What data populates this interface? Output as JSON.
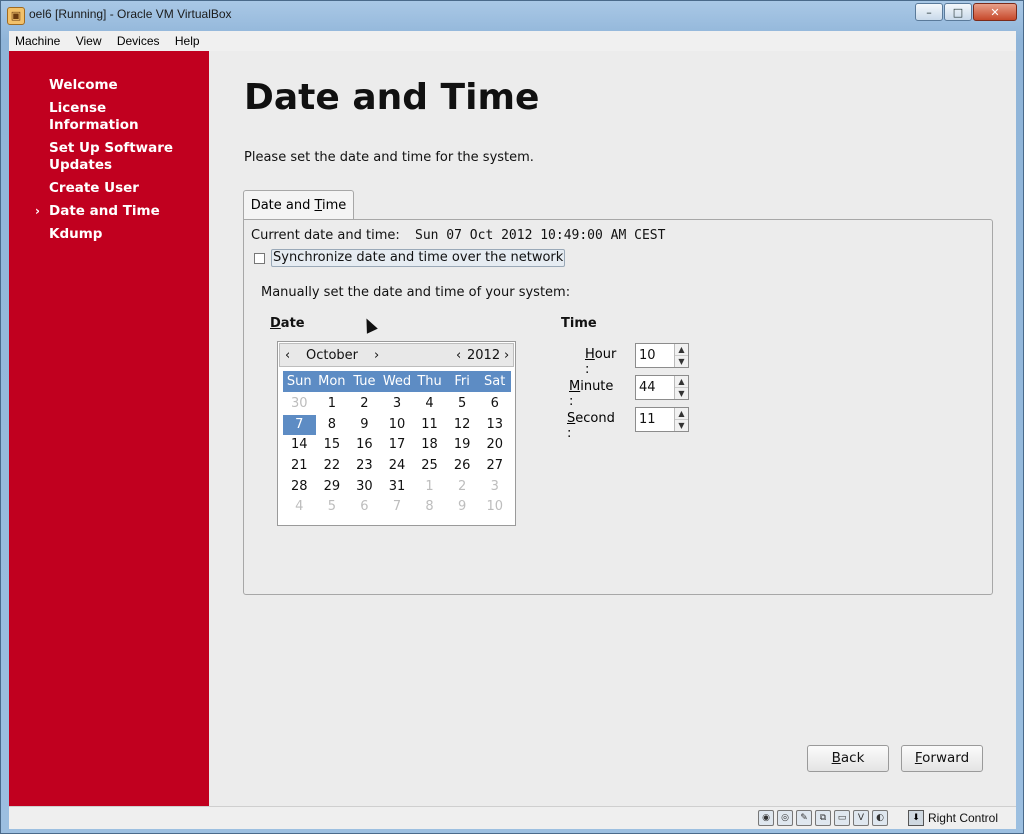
{
  "window": {
    "title": "oel6 [Running] - Oracle VM VirtualBox",
    "menus": [
      "Machine",
      "View",
      "Devices",
      "Help"
    ]
  },
  "sidebar": {
    "items": [
      {
        "label": "Welcome",
        "active": false
      },
      {
        "label": "License Information",
        "active": false
      },
      {
        "label": "Set Up Software Updates",
        "active": false
      },
      {
        "label": "Create User",
        "active": false
      },
      {
        "label": "Date and Time",
        "active": true
      },
      {
        "label": "Kdump",
        "active": false
      }
    ],
    "active_marker": "›"
  },
  "page": {
    "title": "Date and Time",
    "subtitle": "Please set the date and time for the system.",
    "tab_label_pre": "Date and ",
    "tab_label_key": "T",
    "tab_label_post": "ime",
    "current_label": "Current date and time:",
    "current_value": "Sun 07 Oct 2012 10:49:00 AM CEST",
    "sync_label": "Synchronize date and time over the network",
    "sync_checked": false,
    "manual_label": "Manually set the date and time of your system:",
    "date_header_key": "D",
    "date_header_rest": "ate",
    "time_header": "Time"
  },
  "calendar": {
    "month": "October",
    "year": "2012",
    "prev_month": "‹",
    "next_month": "›",
    "prev_year": "‹",
    "next_year": "›",
    "weekdays": [
      "Sun",
      "Mon",
      "Tue",
      "Wed",
      "Thu",
      "Fri",
      "Sat"
    ],
    "days": [
      {
        "d": "30",
        "dim": true
      },
      {
        "d": "1"
      },
      {
        "d": "2"
      },
      {
        "d": "3"
      },
      {
        "d": "4"
      },
      {
        "d": "5"
      },
      {
        "d": "6"
      },
      {
        "d": "7",
        "sel": true
      },
      {
        "d": "8"
      },
      {
        "d": "9"
      },
      {
        "d": "10"
      },
      {
        "d": "11"
      },
      {
        "d": "12"
      },
      {
        "d": "13"
      },
      {
        "d": "14"
      },
      {
        "d": "15"
      },
      {
        "d": "16"
      },
      {
        "d": "17"
      },
      {
        "d": "18"
      },
      {
        "d": "19"
      },
      {
        "d": "20"
      },
      {
        "d": "21"
      },
      {
        "d": "22"
      },
      {
        "d": "23"
      },
      {
        "d": "24"
      },
      {
        "d": "25"
      },
      {
        "d": "26"
      },
      {
        "d": "27"
      },
      {
        "d": "28"
      },
      {
        "d": "29"
      },
      {
        "d": "30"
      },
      {
        "d": "31"
      },
      {
        "d": "1",
        "dim": true
      },
      {
        "d": "2",
        "dim": true
      },
      {
        "d": "3",
        "dim": true
      },
      {
        "d": "4",
        "dim": true
      },
      {
        "d": "5",
        "dim": true
      },
      {
        "d": "6",
        "dim": true
      },
      {
        "d": "7",
        "dim": true
      },
      {
        "d": "8",
        "dim": true
      },
      {
        "d": "9",
        "dim": true
      },
      {
        "d": "10",
        "dim": true
      }
    ]
  },
  "time": {
    "hour": {
      "key": "H",
      "rest": "our :",
      "value": "10"
    },
    "minute": {
      "key": "M",
      "rest": "inute :",
      "value": "44"
    },
    "second": {
      "key": "S",
      "rest": "econd :",
      "value": "11"
    }
  },
  "buttons": {
    "back_key": "B",
    "back_rest": "ack",
    "forward_key": "F",
    "forward_rest": "orward"
  },
  "statusbar": {
    "host_key": "Right Control"
  },
  "colors": {
    "sidebar": "#c1001f",
    "calendar_accent": "#5d8cc4",
    "background": "#ececec"
  }
}
